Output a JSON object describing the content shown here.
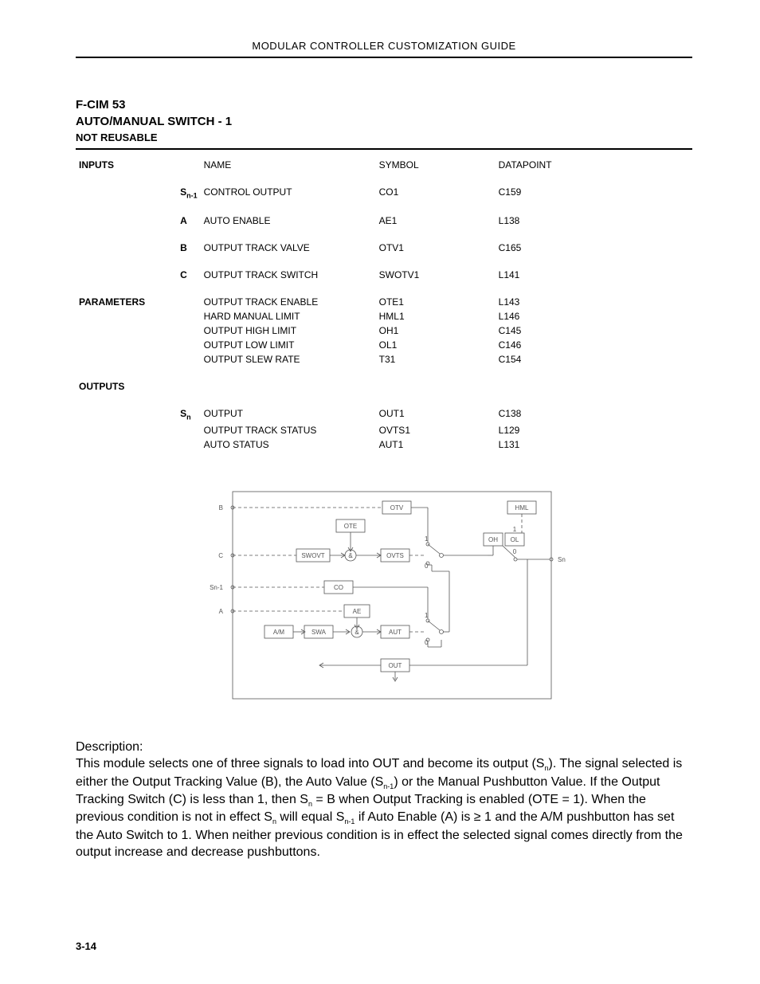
{
  "header": {
    "running_head": "MODULAR CONTROLLER CUSTOMIZATION GUIDE"
  },
  "title": {
    "line1": "F-CIM 53",
    "line2": "AUTO/MANUAL SWITCH - 1",
    "line3": "NOT REUSABLE"
  },
  "table": {
    "headers": {
      "c0": "",
      "c1": "",
      "c2": "NAME",
      "c3": "SYMBOL",
      "c4": "DATAPOINT"
    },
    "sections": {
      "inputs_label": "INPUTS",
      "parameters_label": "PARAMETERS",
      "outputs_label": "OUTPUTS"
    },
    "inputs": [
      {
        "label_main": "S",
        "label_sub": "n-1",
        "name": "CONTROL OUTPUT",
        "symbol": "CO1",
        "datapoint": "C159"
      },
      {
        "label_main": "A",
        "label_sub": "",
        "name": "AUTO ENABLE",
        "symbol": "AE1",
        "datapoint": "L138"
      },
      {
        "label_main": "B",
        "label_sub": "",
        "name": "OUTPUT TRACK VALVE",
        "symbol": "OTV1",
        "datapoint": "C165"
      },
      {
        "label_main": "C",
        "label_sub": "",
        "name": "OUTPUT TRACK SWITCH",
        "symbol": "SWOTV1",
        "datapoint": "L141"
      }
    ],
    "parameters": [
      {
        "name": "OUTPUT TRACK ENABLE",
        "symbol": "OTE1",
        "datapoint": "L143"
      },
      {
        "name": "HARD MANUAL LIMIT",
        "symbol": "HML1",
        "datapoint": "L146"
      },
      {
        "name": "OUTPUT HIGH LIMIT",
        "symbol": "OH1",
        "datapoint": "C145"
      },
      {
        "name": "OUTPUT LOW LIMIT",
        "symbol": "OL1",
        "datapoint": "C146"
      },
      {
        "name": "OUTPUT SLEW RATE",
        "symbol": "T31",
        "datapoint": "C154"
      }
    ],
    "outputs_rowlabel": {
      "main": "S",
      "sub": "n"
    },
    "outputs": [
      {
        "name": "OUTPUT",
        "symbol": "OUT1",
        "datapoint": "C138"
      },
      {
        "name": "OUTPUT TRACK STATUS",
        "symbol": "OVTS1",
        "datapoint": "L129"
      },
      {
        "name": "AUTO STATUS",
        "symbol": "AUT1",
        "datapoint": "L131"
      }
    ]
  },
  "diagram": {
    "ports": {
      "B": "B",
      "C": "C",
      "Sn1": "Sn-1",
      "A": "A",
      "Sn": "Sn"
    },
    "blocks": {
      "OTV": "OTV",
      "OTE": "OTE",
      "SWOVT": "SWOVT",
      "OVTS": "OVTS",
      "CO": "CO",
      "AE": "AE",
      "AM": "A/M",
      "SWA": "SWA",
      "AUT": "AUT",
      "OUT": "OUT",
      "HML": "HML",
      "OH": "OH",
      "OL": "OL",
      "and": "&",
      "one": "1",
      "zero": "0"
    }
  },
  "description": {
    "label": "Description:",
    "p1a": "This module selects one of three signals to load into OUT and become its output (S",
    "p1a_sub": "n",
    "p1b": "). The signal selected is either the Output Tracking Value (B), the Auto Value (S",
    "p1b_sub": "n-1",
    "p1c": ") or the Manual Pushbutton Value. If the Output Tracking Switch (C) is less than 1, then S",
    "p1c_sub": "n",
    "p1d": " = B when Output Tracking is enabled (OTE = 1). When the previous condition is not in effect S",
    "p1d_sub": "n",
    "p1e": " will equal S",
    "p1e_sub": "n-1",
    "p1f": " if Auto Enable (A) is ≥ 1 and the A/M pushbutton has set the Auto Switch to 1. When neither previous condition is in effect the selected signal comes directly from the output increase and decrease pushbuttons."
  },
  "footer": {
    "page": "3-14"
  }
}
